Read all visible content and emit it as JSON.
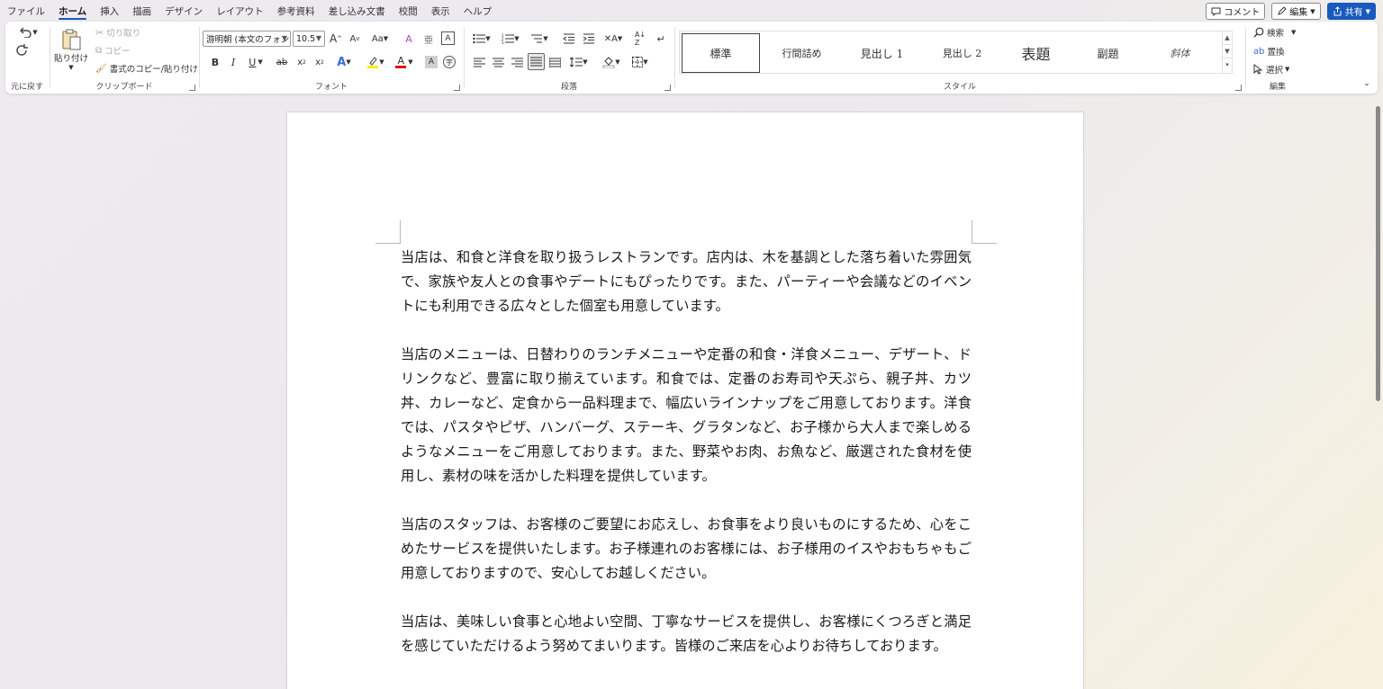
{
  "menubar": {
    "tabs": [
      "ファイル",
      "ホーム",
      "挿入",
      "描画",
      "デザイン",
      "レイアウト",
      "参考資料",
      "差し込み文書",
      "校閲",
      "表示",
      "ヘルプ"
    ],
    "active_tab": "ホーム",
    "comment_label": "コメント",
    "editing_label": "編集",
    "share_label": "共有"
  },
  "ribbon": {
    "undo": {
      "group_label": "元に戻す"
    },
    "clipboard": {
      "paste_label": "貼り付け",
      "cut_label": "切り取り",
      "copy_label": "コピー",
      "format_painter_label": "書式のコピー/貼り付け",
      "group_label": "クリップボード"
    },
    "font": {
      "font_name": "游明朝 (本文のフォン",
      "font_size": "10.5",
      "grow_label": "A",
      "shrink_label": "A",
      "case_label": "Aa",
      "bold": "B",
      "italic": "I",
      "underline": "U",
      "strike": "ab",
      "subscript": "x",
      "superscript": "x",
      "font_color_label": "A",
      "group_label": "フォント"
    },
    "paragraph": {
      "group_label": "段落"
    },
    "styles": {
      "items": [
        "標準",
        "行間詰め",
        "見出し 1",
        "見出し 2",
        "表題",
        "副題",
        "斜体"
      ],
      "selected": "標準",
      "group_label": "スタイル"
    },
    "editing": {
      "find_label": "検索",
      "replace_label": "置換",
      "select_label": "選択",
      "group_label": "編集"
    }
  },
  "document": {
    "paragraphs": [
      "当店は、和食と洋食を取り扱うレストランです。店内は、木を基調とした落ち着いた雰囲気で、家族や友人との食事やデートにもぴったりです。また、パーティーや会議などのイベントにも利用できる広々とした個室も用意しています。",
      "当店のメニューは、日替わりのランチメニューや定番の和食・洋食メニュー、デザート、ドリンクなど、豊富に取り揃えています。和食では、定番のお寿司や天ぷら、親子丼、カツ丼、カレーなど、定食から一品料理まで、幅広いラインナップをご用意しております。洋食では、パスタやピザ、ハンバーグ、ステーキ、グラタンなど、お子様から大人まで楽しめるようなメニューをご用意しております。また、野菜やお肉、お魚など、厳選された食材を使用し、素材の味を活かした料理を提供しています。",
      "当店のスタッフは、お客様のご要望にお応えし、お食事をより良いものにするため、心をこめたサービスを提供いたします。お子様連れのお客様には、お子様用のイスやおもちゃもご用意しておりますので、安心してお越しください。",
      "当店は、美味しい食事と心地よい空間、丁寧なサービスを提供し、お客様にくつろぎと満足を感じていただけるよう努めてまいります。皆様のご来店を心よりお待ちしております。"
    ]
  }
}
